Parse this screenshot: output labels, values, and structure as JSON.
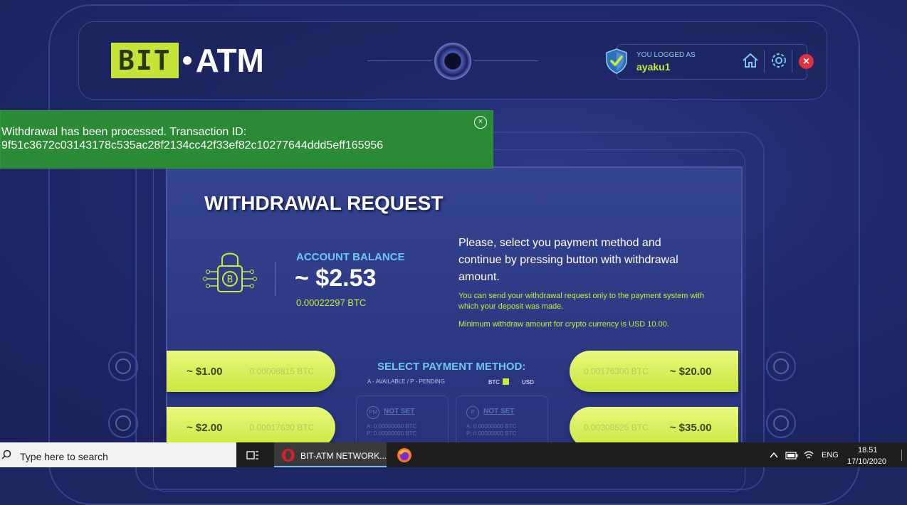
{
  "brand": {
    "bit": "BIT",
    "atm": "ATM"
  },
  "user": {
    "logged_label": "YOU LOGGED AS",
    "username": "ayaku1"
  },
  "notification": {
    "line1": "Withdrawal has been processed. Transaction ID:",
    "line2": "9f51c3672c03143178c535ac28f2134cc42f33ef82c10277644ddd5eff165956",
    "close": "×"
  },
  "page": {
    "title": "WITHDRAWAL REQUEST"
  },
  "balance": {
    "label": "ACCOUNT BALANCE",
    "value": "~ $2.53",
    "btc": "0.00022297 BTC"
  },
  "instructions": {
    "main": "Please, select you payment method and continue by pressing button with withdrawal amount.",
    "note1": "You can send your withdrawal request only to the payment system with which your deposit was made.",
    "note2": "Minimum withdraw amount for crypto currency is USD 10.00."
  },
  "amounts": {
    "left": [
      {
        "usd": "~ $1.00",
        "btc": "0.00008815 BTC"
      },
      {
        "usd": "~ $2.00",
        "btc": "0.00017630 BTC"
      }
    ],
    "right": [
      {
        "usd": "~ $20.00",
        "btc": "0.00176300 BTC"
      },
      {
        "usd": "~ $35.00",
        "btc": "0.00308525 BTC"
      }
    ]
  },
  "payment_method": {
    "title": "SELECT PAYMENT METHOD:",
    "legend": "A - AVAILABLE / P - PENDING",
    "toggle_btc": "BTC",
    "toggle_usd": "USD",
    "cards": [
      {
        "icon": "PM",
        "status": "NOT SET",
        "a": "A: 0.00000000 BTC",
        "p": "P: 0.00000000 BTC"
      },
      {
        "icon": "P",
        "status": "NOT SET",
        "a": "A: 0.00000000 BTC",
        "p": "P: 0.00000000 BTC"
      }
    ]
  },
  "taskbar": {
    "search_placeholder": "Type here to search",
    "app_label": "BIT-ATM NETWORK...",
    "lang": "ENG",
    "time": "18.51",
    "date": "17/10/2020"
  },
  "colors": {
    "accent_lime": "#c8ec3a",
    "accent_blue": "#6ec6f2",
    "notice_green": "#2a8a35",
    "close_red": "#e0313c"
  }
}
